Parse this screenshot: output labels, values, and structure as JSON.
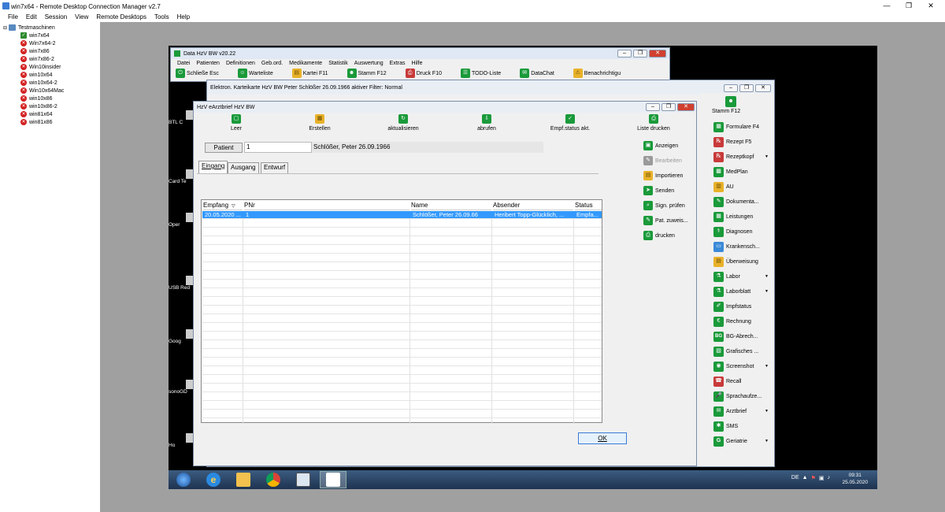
{
  "outer": {
    "title": "win7x64 - Remote Desktop Connection Manager v2.7",
    "menu": [
      "File",
      "Edit",
      "Session",
      "View",
      "Remote Desktops",
      "Tools",
      "Help"
    ],
    "controls": {
      "minimize": "—",
      "maximize": "❐",
      "close": "✕"
    }
  },
  "tree": {
    "root": "Testmaschinen",
    "items": [
      "win7x64",
      "Win7x64-2",
      "win7x86",
      "win7x86-2",
      "Win10insider",
      "win10x64",
      "win10x64-2",
      "Win10x64Mac",
      "win10x86",
      "win10x86-2",
      "win81x64",
      "win81x86"
    ]
  },
  "desktop": {
    "icons": [
      "BTL C",
      "Card Te",
      "Oper",
      "USB Red",
      "Goog",
      "sonoGD",
      "Ho"
    ]
  },
  "taskbar": {
    "lang": "DE",
    "time": "09:31",
    "date": "25.05.2020"
  },
  "main_window": {
    "title": "Data HzV BW v20.22",
    "menu": [
      "Datei",
      "Patienten",
      "Definitionen",
      "Geb.ord.",
      "Medikamente",
      "Statistik",
      "Auswertung",
      "Extras",
      "Hilfe"
    ],
    "toolbar": [
      "Schließe Esc",
      "Warteliste",
      "Kartei F11",
      "Stamm F12",
      "Druck F10",
      "TODO-Liste",
      "DataChat",
      "Benachrichtigu"
    ]
  },
  "kartei_window": {
    "title": "Elektron. Karteikarte HzV BW Peter Schlößer 26.09.1966  aktiver Filter: Normal"
  },
  "dialog": {
    "title": "HzV eArztbrief HzV BW",
    "toolbar": [
      "Leer",
      "Erstellen",
      "aktualisieren",
      "abrufen",
      "Empf.status akt.",
      "Liste drucken"
    ],
    "patient_label": "Patient",
    "patient_nr": "1",
    "patient_name": "Schlößer, Peter 26.09.1966",
    "tabs": [
      "Eingang",
      "Ausgang",
      "Entwurf"
    ],
    "columns": [
      "Empfang",
      "PNr",
      "Name",
      "Absender",
      "Status"
    ],
    "rows": [
      {
        "empfang": "20.05.2020 ...",
        "pnr": "1",
        "name": "Schlößer, Peter 26.09.66",
        "absender": "Heribert Topp-Glücklich, ...",
        "status": "Empfa..."
      }
    ],
    "side_actions": [
      "Anzeigen",
      "Bearbeiten",
      "Importieren",
      "Senden",
      "Sign. prüfen",
      "Pat. zuweis...",
      "drucken"
    ],
    "ok_label": "OK"
  },
  "right_panel": {
    "header": "Stamm F12",
    "items": [
      "Formulare F4",
      "Rezept F5",
      "Rezeptkopf",
      "MedPlan",
      "AU",
      "Dokumenta...",
      "Leistungen",
      "Diagnosen",
      "Krankensch...",
      "Überweisung",
      "Labor",
      "Laborblatt",
      "Impfstatus",
      "Rechnung",
      "BG-Abrech...",
      "Grafisches ...",
      "Screenshot",
      "Recall",
      "Sprachaufze...",
      "Arztbrief",
      "SMS",
      "Geriatrie"
    ]
  }
}
